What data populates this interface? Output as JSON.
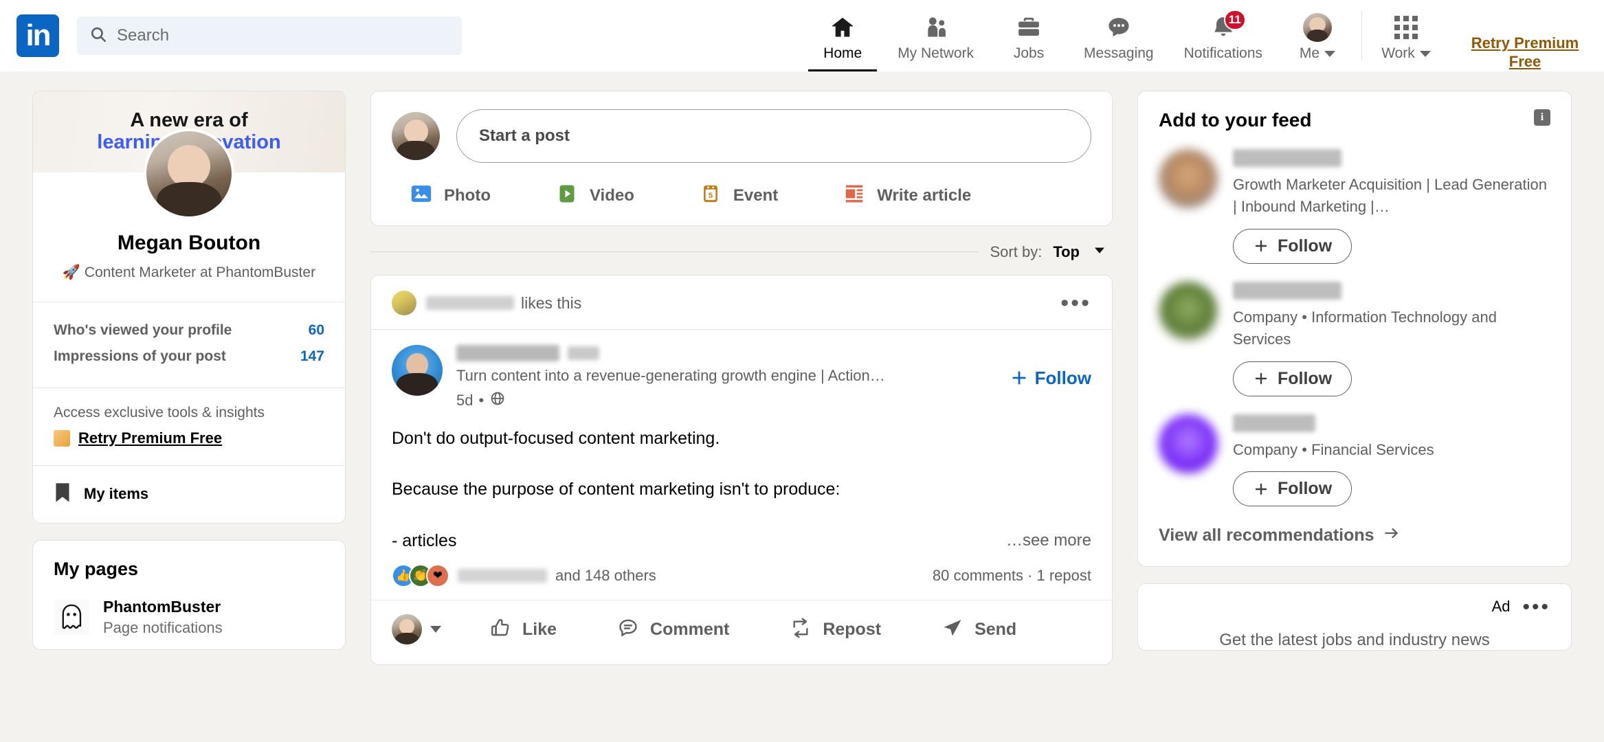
{
  "nav": {
    "logo": "in",
    "search": {
      "placeholder": "Search",
      "value": "",
      "icon": "search-icon"
    },
    "items": [
      {
        "label": "Home",
        "icon": "home-icon",
        "active": true
      },
      {
        "label": "My Network",
        "icon": "people-icon",
        "active": false
      },
      {
        "label": "Jobs",
        "icon": "briefcase-icon",
        "active": false
      },
      {
        "label": "Messaging",
        "icon": "message-bubble-icon",
        "active": false
      },
      {
        "label": "Notifications",
        "icon": "bell-icon",
        "active": false,
        "badge": "11"
      },
      {
        "label": "Me",
        "icon": "avatar-icon",
        "active": false,
        "caret": true
      }
    ],
    "work": {
      "label": "Work",
      "icon": "app-grid-icon"
    },
    "premium": "Retry Premium Free",
    "premium_color": "#915907",
    "accent_color": "#0a66c2",
    "badge_color": "#cb112d"
  },
  "sidebar": {
    "banner": {
      "line1": "A new era of",
      "line2": "learning innovation"
    },
    "name": "Megan Bouton",
    "headline": "🚀 Content Marketer at PhantomBuster",
    "stats": [
      {
        "label": "Who's viewed your profile",
        "value": "60"
      },
      {
        "label": "Impressions of your post",
        "value": "147"
      }
    ],
    "premium": {
      "subtitle": "Access exclusive tools & insights",
      "cta": "Retry Premium Free"
    },
    "my_items": {
      "label": "My items",
      "icon": "bookmark-icon"
    },
    "my_pages": {
      "title": "My pages",
      "pages": [
        {
          "name": "PhantomBuster",
          "sub": "Page notifications",
          "icon": "ghost-icon"
        }
      ]
    }
  },
  "composer": {
    "placeholder": "Start a post",
    "actions": [
      {
        "label": "Photo",
        "icon": "photo-icon",
        "color": "#378fe9"
      },
      {
        "label": "Video",
        "icon": "video-icon",
        "color": "#5f9b41"
      },
      {
        "label": "Event",
        "icon": "calendar-icon",
        "color": "#c37d16"
      },
      {
        "label": "Write article",
        "icon": "article-icon",
        "color": "#e06847"
      }
    ]
  },
  "sort": {
    "prefix": "Sort by:",
    "value": "Top",
    "icon": "chevron-down-icon"
  },
  "post": {
    "context": {
      "actor": "",
      "text": "likes this"
    },
    "author": {
      "name": "",
      "degree": "",
      "headline": "Turn content into a revenue-generating growth engine | Action…",
      "time": "5d",
      "visibility": "globe-icon"
    },
    "follow": "Follow",
    "lines": [
      "Don't do output-focused content marketing.",
      "Because the purpose of content marketing isn't to produce:",
      "- articles"
    ],
    "see_more": "…see more",
    "social": {
      "reactions": [
        "like-icon",
        "clap-icon",
        "love-icon"
      ],
      "text": "and 148 others",
      "comments": "80 comments · 1 repost"
    },
    "actions": [
      {
        "label": "Like",
        "icon": "thumbs-up-icon"
      },
      {
        "label": "Comment",
        "icon": "comment-icon"
      },
      {
        "label": "Repost",
        "icon": "repost-icon"
      },
      {
        "label": "Send",
        "icon": "send-icon"
      }
    ]
  },
  "right": {
    "feed": {
      "title": "Add to your feed",
      "info_icon": "info-icon",
      "entries": [
        {
          "name": "",
          "desc": "Growth Marketer Acquisition | Lead Generation | Inbound Marketing |…",
          "follow": "Follow"
        },
        {
          "name": "",
          "desc": "Company • Information Technology and Services",
          "follow": "Follow"
        },
        {
          "name": "",
          "desc": "Company • Financial Services",
          "follow": "Follow"
        }
      ],
      "view_all": "View all recommendations"
    },
    "ad": {
      "label": "Ad",
      "dots": "•••",
      "text": "Get the latest jobs and industry news"
    }
  }
}
